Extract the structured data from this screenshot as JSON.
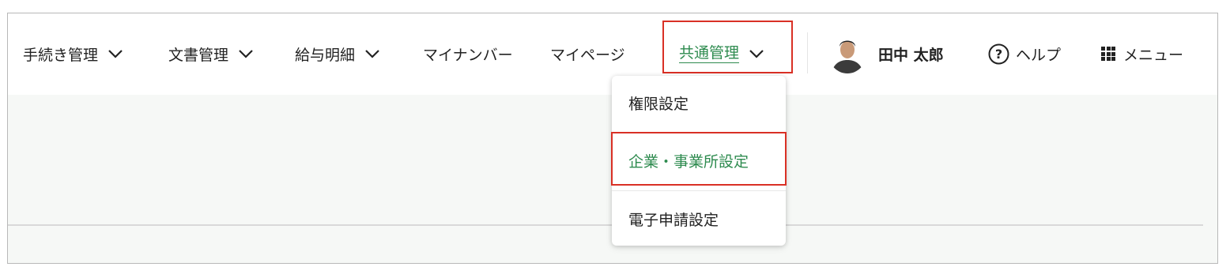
{
  "nav": {
    "items": [
      {
        "label": "手続き管理",
        "has_chevron": true
      },
      {
        "label": "文書管理",
        "has_chevron": true
      },
      {
        "label": "給与明細",
        "has_chevron": true
      },
      {
        "label": "マイナンバー",
        "has_chevron": false
      },
      {
        "label": "マイページ",
        "has_chevron": false
      },
      {
        "label": "共通管理",
        "has_chevron": true,
        "active": true
      }
    ]
  },
  "user": {
    "name": "田中 太郎",
    "avatar_icon": "user-avatar-photo"
  },
  "help": {
    "label": "ヘルプ",
    "icon": "question-circle-icon"
  },
  "menu": {
    "label": "メニュー",
    "icon": "grid-icon"
  },
  "dropdown": {
    "items": [
      {
        "label": "権限設定"
      },
      {
        "label": "企業・事業所設定",
        "active": true
      },
      {
        "label": "電子申請設定"
      }
    ]
  },
  "colors": {
    "accent": "#2e8b4f",
    "highlight": "#d93025",
    "text": "#222222",
    "content_bg": "#f6f8f6"
  }
}
